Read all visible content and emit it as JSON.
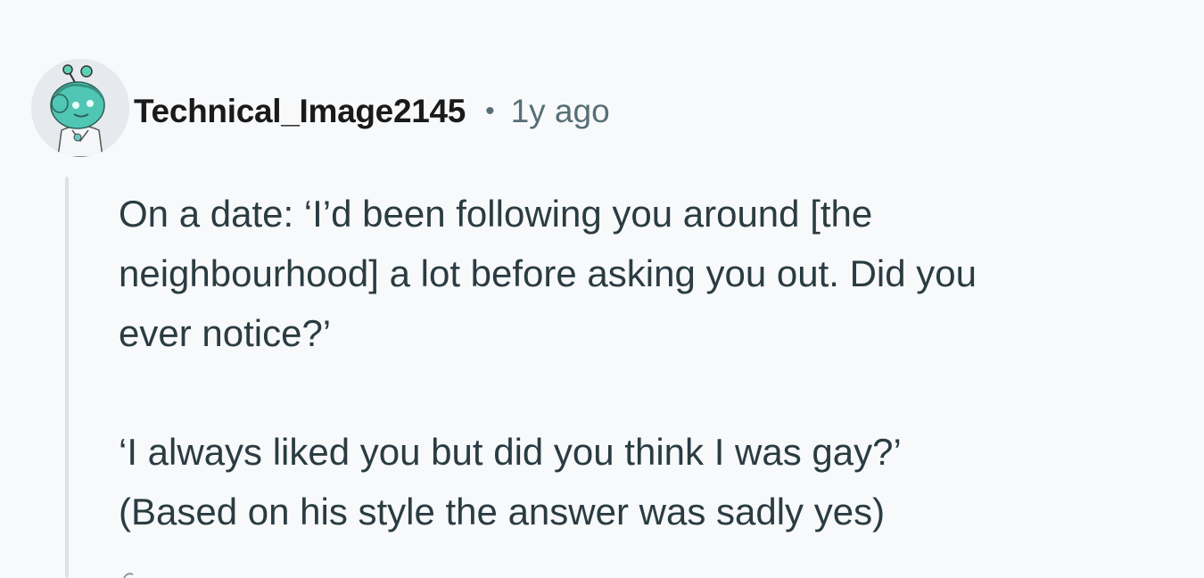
{
  "comment": {
    "author": "Technical_Image2145",
    "separator": "•",
    "age": "1y ago",
    "avatar_icon": "snoo-avatar-icon",
    "paragraphs": [
      [
        "On a date: ‘I’d been following you around [the",
        "neighbourhood] a lot before asking you out. Did you",
        "ever notice?’"
      ],
      [
        "‘I always liked you but did you think I was gay?’",
        "(Based on his style the answer was sadly yes)"
      ]
    ]
  },
  "colors": {
    "background": "#f8f9fb",
    "author": "#1a1a1b",
    "meta": "#576f76",
    "body_text": "#2a3c42",
    "thread_line": "#dde2e7",
    "avatar_teal": "#4fc7b4"
  }
}
